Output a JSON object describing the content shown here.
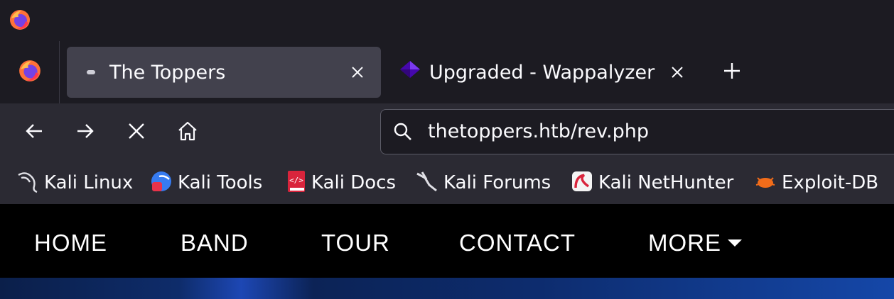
{
  "browser": {
    "tabs": [
      {
        "title": "The Toppers",
        "active": true,
        "favicon": "dot-icon"
      },
      {
        "title": "Upgraded - Wappalyzer",
        "active": false,
        "favicon": "wappalyzer-icon"
      }
    ],
    "url": "thetoppers.htb/rev.php",
    "nav_icons": [
      "back-arrow-icon",
      "forward-arrow-icon",
      "stop-icon",
      "home-icon",
      "search-icon"
    ],
    "bookmarks": [
      {
        "label": "Kali Linux",
        "icon": "kali-dragon-icon"
      },
      {
        "label": "Kali Tools",
        "icon": "kali-tools-icon"
      },
      {
        "label": "Kali Docs",
        "icon": "kali-docs-icon"
      },
      {
        "label": "Kali Forums",
        "icon": "kali-forums-icon"
      },
      {
        "label": "Kali NetHunter",
        "icon": "nethunter-icon"
      },
      {
        "label": "Exploit-DB",
        "icon": "exploit-db-icon"
      }
    ]
  },
  "site": {
    "nav": [
      "HOME",
      "BAND",
      "TOUR",
      "CONTACT",
      "MORE"
    ]
  },
  "colors": {
    "chrome_dark": "#1c1b22",
    "toolbar": "#2b2a33",
    "active_tab": "#42414d",
    "site_nav": "#000000",
    "hero_blue": "#1547a8"
  }
}
